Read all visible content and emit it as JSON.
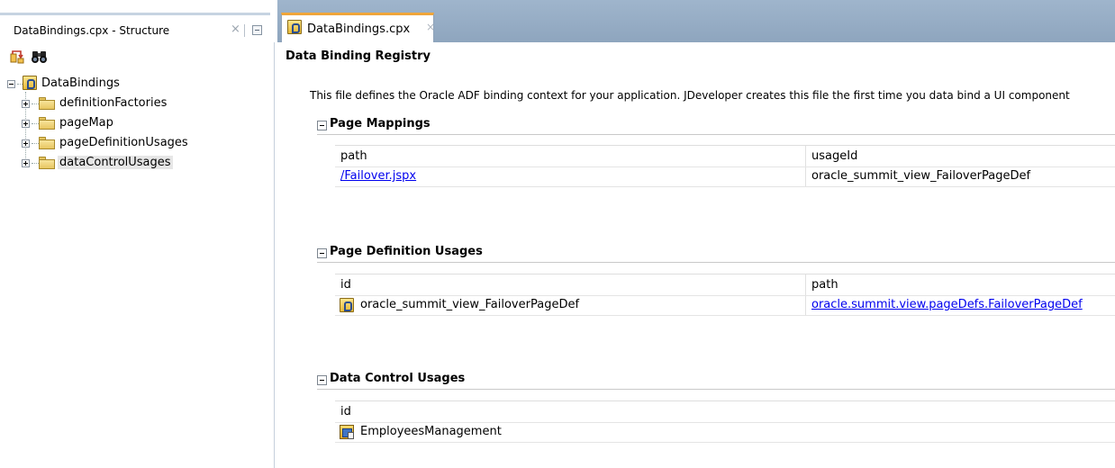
{
  "structure_pane": {
    "title": "DataBindings.cpx - Structure",
    "close_glyph": "×",
    "toolbar": [
      {
        "icon": "open-structure-icon",
        "glyph": "⮤"
      },
      {
        "icon": "find-binoculars-icon",
        "glyph": "👓"
      }
    ],
    "tree": {
      "root": "DataBindings",
      "children": [
        "definitionFactories",
        "pageMap",
        "pageDefinitionUsages",
        "dataControlUsages"
      ],
      "selected": "dataControlUsages"
    }
  },
  "editor_tab": {
    "title": "DataBindings.cpx",
    "close_glyph": "×"
  },
  "editor": {
    "heading": "Data Binding Registry",
    "description": "This file defines the Oracle ADF binding context for your application. JDeveloper creates this file the first time you data bind a UI component",
    "sections": {
      "page_mappings": {
        "title": "Page Mappings",
        "columns": [
          "path",
          "usageId"
        ],
        "rows": [
          [
            "/Failover.jspx",
            "oracle_summit_view_FailoverPageDef"
          ]
        ]
      },
      "page_definition_usages": {
        "title": "Page Definition Usages",
        "columns": [
          "id",
          "path"
        ],
        "rows": [
          [
            "oracle_summit_view_FailoverPageDef",
            "oracle.summit.view.pageDefs.FailoverPageDef"
          ]
        ]
      },
      "data_control_usages": {
        "title": "Data Control Usages",
        "columns": [
          "id"
        ],
        "rows": [
          [
            "EmployeesManagement"
          ]
        ]
      }
    }
  },
  "colors": {
    "link": "#0000ee",
    "tab_accent": "#f0a63a",
    "tabbar": "#9fb5cc",
    "selection": "#e6e6e6"
  }
}
